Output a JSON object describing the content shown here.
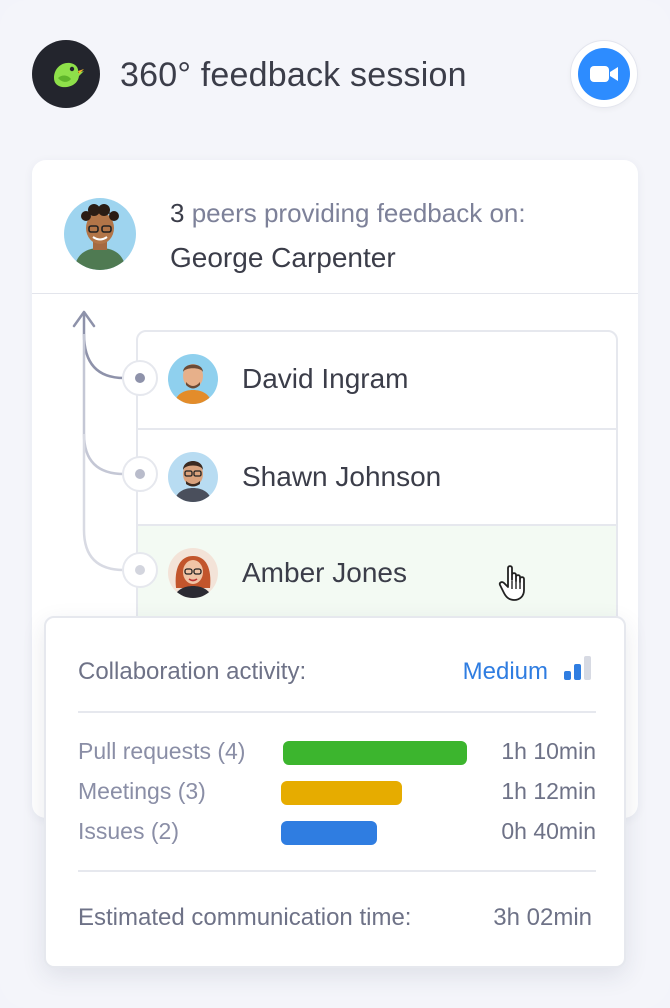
{
  "header": {
    "title": "360° feedback session",
    "logo_icon": "bird-icon",
    "video_icon": "video-camera-icon",
    "video_color": "#2d8cff"
  },
  "subject": {
    "peer_count": "3",
    "peers_text": "peers providing feedback on:",
    "name": "George Carpenter"
  },
  "peers": [
    {
      "name": "David Ingram",
      "active": false
    },
    {
      "name": "Shawn Johnson",
      "active": false
    },
    {
      "name": "Amber Jones",
      "active": true
    }
  ],
  "collaboration": {
    "label": "Collaboration activity:",
    "level": "Medium",
    "level_color": "#2f7de1",
    "signal_level": 2,
    "signal_max": 3,
    "metrics": [
      {
        "label": "Pull requests (4)",
        "time": "1h 10min",
        "color": "#3cb52e",
        "bar_fraction": 1.0
      },
      {
        "label": "Meetings (3)",
        "time": "1h 12min",
        "color": "#e6ac00",
        "bar_fraction": 0.66
      },
      {
        "label": "Issues (2)",
        "time": "0h 40min",
        "color": "#2f7de1",
        "bar_fraction": 0.52
      }
    ],
    "estimate_label": "Estimated communication time:",
    "estimate_value": "3h 02min"
  }
}
